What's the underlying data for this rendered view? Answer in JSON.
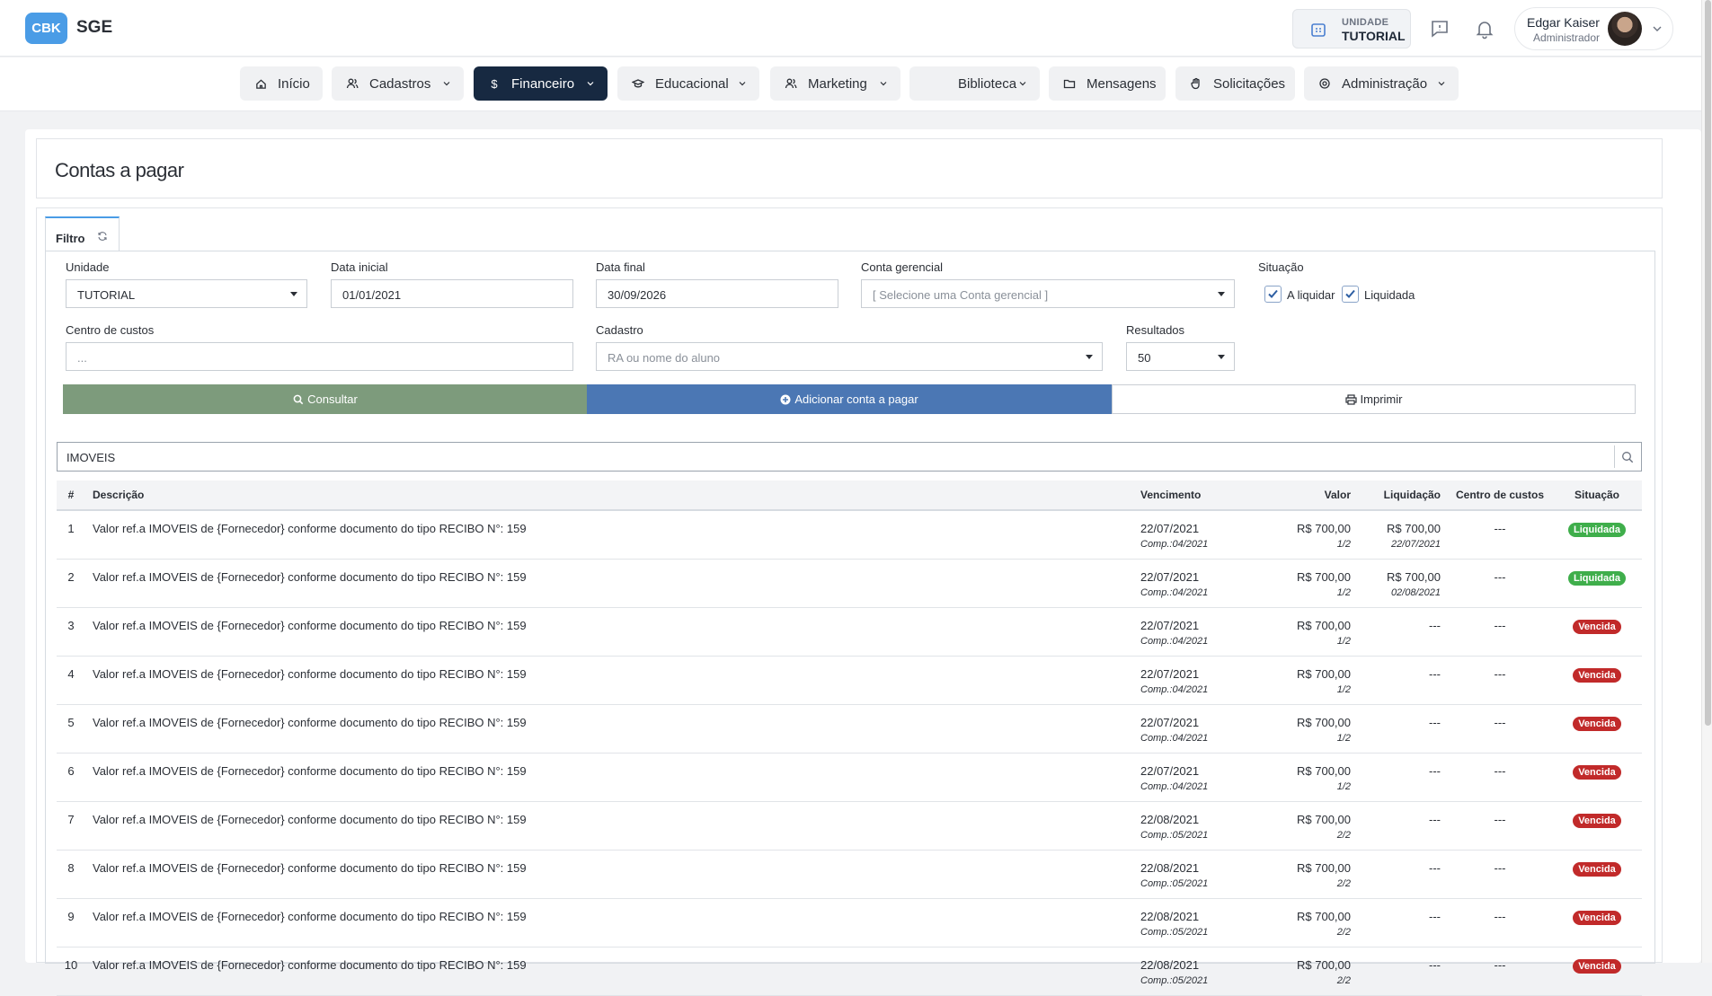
{
  "header": {
    "logo": "CBK",
    "app_name": "SGE",
    "unit_label": "UNIDADE",
    "unit_value": "TUTORIAL",
    "user_name": "Edgar Kaiser",
    "user_role": "Administrador"
  },
  "nav": {
    "items": [
      {
        "label": "Início",
        "icon": "home-icon"
      },
      {
        "label": "Cadastros",
        "icon": "users-icon"
      },
      {
        "label": "Financeiro",
        "icon": "dollar-icon"
      },
      {
        "label": "Educacional",
        "icon": "graduation-cap-icon"
      },
      {
        "label": "Marketing",
        "icon": "users-icon"
      },
      {
        "label": "Biblioteca",
        "icon": "book-icon"
      },
      {
        "label": "Mensagens",
        "icon": "folder-icon"
      },
      {
        "label": "Solicitações",
        "icon": "hand-icon"
      },
      {
        "label": "Administração",
        "icon": "gear-icon"
      }
    ]
  },
  "page": {
    "title": "Contas a pagar"
  },
  "filter": {
    "tab_label": "Filtro",
    "unidade_label": "Unidade",
    "unidade_value": "TUTORIAL",
    "data_inicial_label": "Data inicial",
    "data_inicial_value": "01/01/2021",
    "data_final_label": "Data final",
    "data_final_value": "30/09/2026",
    "conta_label": "Conta gerencial",
    "conta_placeholder": "[ Selecione uma Conta gerencial ]",
    "situacao_label": "Situação",
    "a_liquidar_label": "A liquidar",
    "liquidada_label": "Liquidada",
    "centro_label": "Centro de custos",
    "centro_placeholder": "...",
    "cadastro_label": "Cadastro",
    "cadastro_placeholder": "RA ou nome do aluno",
    "resultados_label": "Resultados",
    "resultados_value": "50",
    "consultar_label": "Consultar",
    "adicionar_label": "Adicionar conta a pagar",
    "imprimir_label": "Imprimir"
  },
  "search": {
    "value": "IMOVEIS"
  },
  "table": {
    "headers": {
      "num": "#",
      "desc": "Descrição",
      "venc": "Vencimento",
      "valor": "Valor",
      "liq": "Liquidação",
      "cc": "Centro de custos",
      "sit": "Situação"
    },
    "rows": [
      {
        "num": "1",
        "desc": "Valor ref.a IMOVEIS de {Fornecedor} conforme documento do tipo RECIBO N°: 159",
        "venc": "22/07/2021",
        "comp": "Comp.:04/2021",
        "valor": "R$ 700,00",
        "parc": "1/2",
        "liq": "R$ 700,00",
        "liq_date": "22/07/2021",
        "cc": "---",
        "sit": "Liquidada"
      },
      {
        "num": "2",
        "desc": "Valor ref.a IMOVEIS de {Fornecedor} conforme documento do tipo RECIBO N°: 159",
        "venc": "22/07/2021",
        "comp": "Comp.:04/2021",
        "valor": "R$ 700,00",
        "parc": "1/2",
        "liq": "R$ 700,00",
        "liq_date": "02/08/2021",
        "cc": "---",
        "sit": "Liquidada"
      },
      {
        "num": "3",
        "desc": "Valor ref.a IMOVEIS de {Fornecedor} conforme documento do tipo RECIBO N°: 159",
        "venc": "22/07/2021",
        "comp": "Comp.:04/2021",
        "valor": "R$ 700,00",
        "parc": "1/2",
        "liq": "---",
        "liq_date": "",
        "cc": "---",
        "sit": "Vencida"
      },
      {
        "num": "4",
        "desc": "Valor ref.a IMOVEIS de {Fornecedor} conforme documento do tipo RECIBO N°: 159",
        "venc": "22/07/2021",
        "comp": "Comp.:04/2021",
        "valor": "R$ 700,00",
        "parc": "1/2",
        "liq": "---",
        "liq_date": "",
        "cc": "---",
        "sit": "Vencida"
      },
      {
        "num": "5",
        "desc": "Valor ref.a IMOVEIS de {Fornecedor} conforme documento do tipo RECIBO N°: 159",
        "venc": "22/07/2021",
        "comp": "Comp.:04/2021",
        "valor": "R$ 700,00",
        "parc": "1/2",
        "liq": "---",
        "liq_date": "",
        "cc": "---",
        "sit": "Vencida"
      },
      {
        "num": "6",
        "desc": "Valor ref.a IMOVEIS de {Fornecedor} conforme documento do tipo RECIBO N°: 159",
        "venc": "22/07/2021",
        "comp": "Comp.:04/2021",
        "valor": "R$ 700,00",
        "parc": "1/2",
        "liq": "---",
        "liq_date": "",
        "cc": "---",
        "sit": "Vencida"
      },
      {
        "num": "7",
        "desc": "Valor ref.a IMOVEIS de {Fornecedor} conforme documento do tipo RECIBO N°: 159",
        "venc": "22/08/2021",
        "comp": "Comp.:05/2021",
        "valor": "R$ 700,00",
        "parc": "2/2",
        "liq": "---",
        "liq_date": "",
        "cc": "---",
        "sit": "Vencida"
      },
      {
        "num": "8",
        "desc": "Valor ref.a IMOVEIS de {Fornecedor} conforme documento do tipo RECIBO N°: 159",
        "venc": "22/08/2021",
        "comp": "Comp.:05/2021",
        "valor": "R$ 700,00",
        "parc": "2/2",
        "liq": "---",
        "liq_date": "",
        "cc": "---",
        "sit": "Vencida"
      },
      {
        "num": "9",
        "desc": "Valor ref.a IMOVEIS de {Fornecedor} conforme documento do tipo RECIBO N°: 159",
        "venc": "22/08/2021",
        "comp": "Comp.:05/2021",
        "valor": "R$ 700,00",
        "parc": "2/2",
        "liq": "---",
        "liq_date": "",
        "cc": "---",
        "sit": "Vencida"
      },
      {
        "num": "10",
        "desc": "Valor ref.a IMOVEIS de {Fornecedor} conforme documento do tipo RECIBO N°: 159",
        "venc": "22/08/2021",
        "comp": "Comp.:05/2021",
        "valor": "R$ 700,00",
        "parc": "2/2",
        "liq": "---",
        "liq_date": "",
        "cc": "---",
        "sit": "Vencida"
      }
    ]
  },
  "colors": {
    "accent": "#4a9ce6",
    "nav_active": "#172941",
    "btn_consultar": "#7d9b7c",
    "btn_adicionar": "#4b77b4",
    "badge_liquidada": "#3fae4b",
    "badge_vencida": "#c12a2a"
  }
}
